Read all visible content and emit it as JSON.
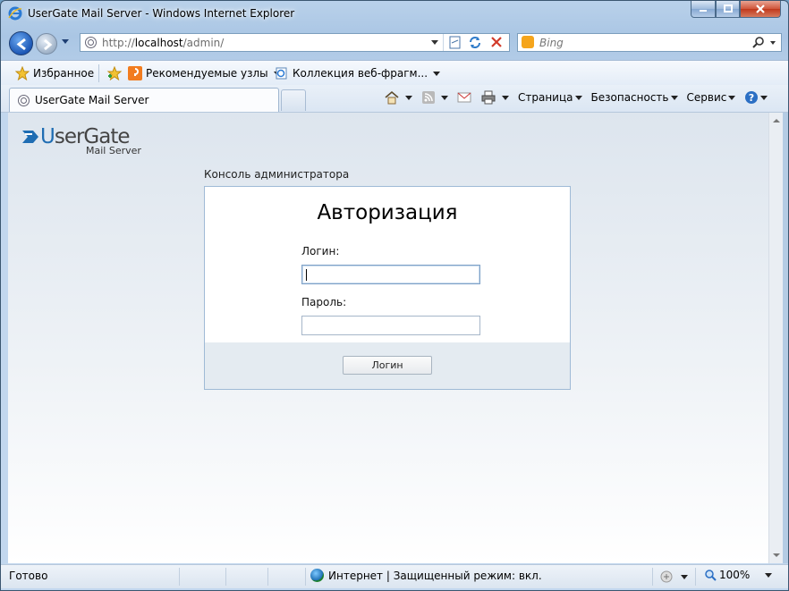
{
  "window": {
    "title": "UserGate Mail Server - Windows Internet Explorer"
  },
  "address_bar": {
    "url_prefix": "http://",
    "url_host": "localhost",
    "url_path": "/admin/"
  },
  "search_box": {
    "placeholder": "Bing"
  },
  "favorites_bar": {
    "favorites_label": "Избранное",
    "items": [
      {
        "label": "Рекомендуемые узлы"
      },
      {
        "label": "Коллекция веб-фрагм..."
      }
    ]
  },
  "tabs": [
    {
      "label": "UserGate Mail Server"
    }
  ],
  "command_bar": {
    "page_label": "Страница",
    "safety_label": "Безопасность",
    "tools_label": "Сервис"
  },
  "logo": {
    "brand": "UserGate",
    "brand_first": "U",
    "brand_rest": "serGate",
    "product": "Mail Server"
  },
  "page": {
    "console_label": "Консоль администратора",
    "heading": "Авторизация",
    "login_label": "Логин:",
    "password_label": "Пароль:",
    "login_value": "",
    "password_value": "",
    "submit_label": "Логин"
  },
  "status_bar": {
    "status": "Готово",
    "zone": "Интернет | Защищенный режим: вкл.",
    "zoom": "100%"
  },
  "colors": {
    "brand_blue": "#1f6db3",
    "footer_bg": "#e4ebf1",
    "box_border": "#9fbad6"
  }
}
